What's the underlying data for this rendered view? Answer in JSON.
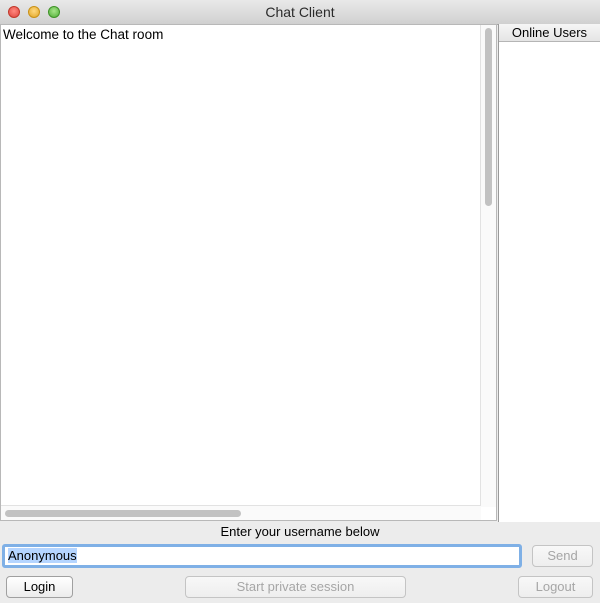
{
  "window": {
    "title": "Chat Client"
  },
  "chat": {
    "messages": [
      "Welcome to the Chat room"
    ]
  },
  "users_panel": {
    "header": "Online Users",
    "users": []
  },
  "login": {
    "prompt": "Enter your username below",
    "username_value": "Anonymous",
    "send_label": "Send",
    "login_label": "Login",
    "private_session_label": "Start private session",
    "logout_label": "Logout"
  },
  "colors": {
    "input_focus_ring": "#7fb0e6",
    "selection": "#b5d5ff"
  }
}
